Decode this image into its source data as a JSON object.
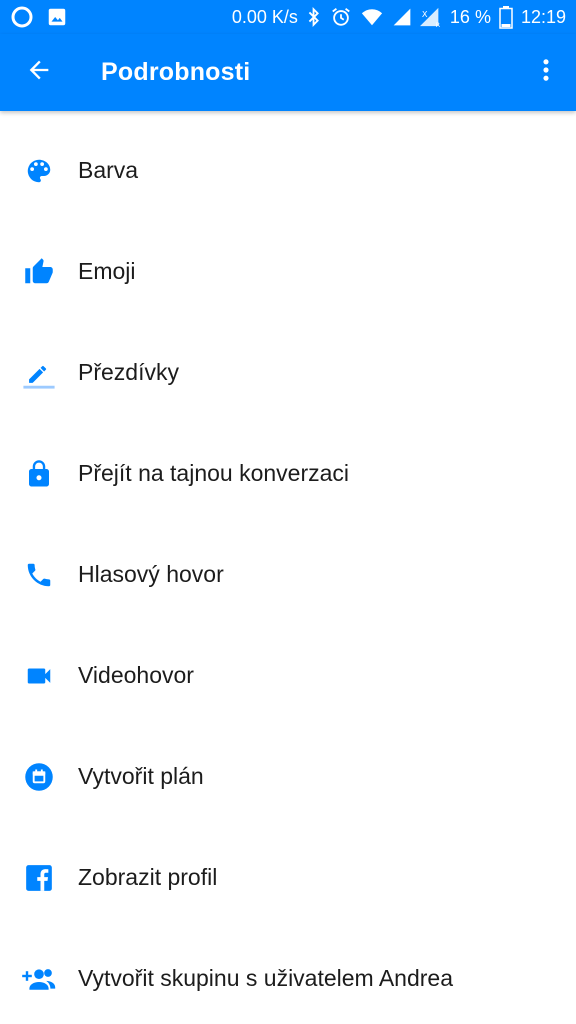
{
  "status_bar": {
    "network_speed": "0.00 K/s",
    "battery_percent": "16 %",
    "time": "12:19",
    "icons": [
      "loading-circle-icon",
      "image-icon",
      "bluetooth-icon",
      "alarm-icon",
      "wifi-icon",
      "signal-icon",
      "signal-roaming-icon",
      "battery-icon"
    ]
  },
  "app_bar": {
    "title": "Podrobnosti",
    "back_icon": "arrow-back-icon",
    "more_icon": "more-vertical-icon"
  },
  "menu": {
    "items": [
      {
        "label": "Barva",
        "icon": "palette-icon"
      },
      {
        "label": "Emoji",
        "icon": "thumbs-up-icon"
      },
      {
        "label": "Přezdívky",
        "icon": "pencil-icon"
      },
      {
        "label": "Přejít na tajnou konverzaci",
        "icon": "lock-icon"
      },
      {
        "label": "Hlasový hovor",
        "icon": "phone-icon"
      },
      {
        "label": "Videohovor",
        "icon": "video-camera-icon"
      },
      {
        "label": "Vytvořit plán",
        "icon": "calendar-icon"
      },
      {
        "label": "Zobrazit profil",
        "icon": "facebook-icon"
      },
      {
        "label": "Vytvořit skupinu s uživatelem Andrea",
        "icon": "add-group-icon"
      }
    ]
  },
  "colors": {
    "primary": "#0084ff",
    "icon": "#0084ff",
    "text": "#1c1c1c",
    "background": "#ffffff"
  }
}
